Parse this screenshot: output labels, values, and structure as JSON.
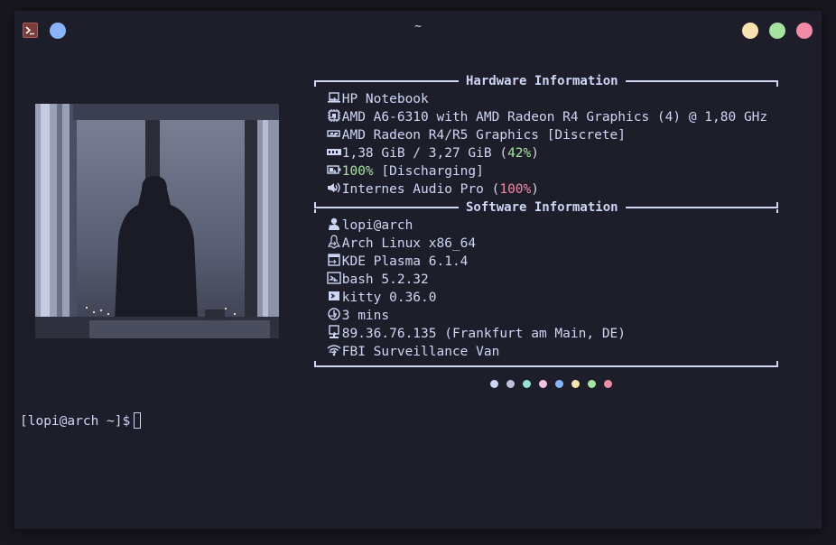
{
  "window": {
    "title": "~",
    "traffic_colors": [
      "#f9e2af",
      "#a6e3a1",
      "#f38ba8"
    ],
    "accent_dot_color": "#89b4fa"
  },
  "hardware": {
    "title": "Hardware Information",
    "rows": [
      {
        "icon": "laptop-icon",
        "text": "HP Notebook"
      },
      {
        "icon": "cpu-icon",
        "text": "AMD A6-6310 with AMD Radeon R4 Graphics (4) @ 1,80 GHz"
      },
      {
        "icon": "gpu-icon",
        "text": "AMD Radeon R4/R5 Graphics [Discrete]"
      },
      {
        "icon": "memory-icon",
        "prefix": "1,38 GiB / 3,27 GiB (",
        "value": "42%",
        "suffix": ")"
      },
      {
        "icon": "battery-icon",
        "value": "100%",
        "suffix": " [Discharging]"
      },
      {
        "icon": "speaker-icon",
        "prefix": "Internes Audio Pro (",
        "value": "100%",
        "suffix": ")"
      }
    ]
  },
  "software": {
    "title": "Software Information",
    "rows": [
      {
        "icon": "user-icon",
        "text": "lopi@arch"
      },
      {
        "icon": "linux-icon",
        "text": "Arch Linux x86_64"
      },
      {
        "icon": "window-icon",
        "text": "KDE Plasma 6.1.4"
      },
      {
        "icon": "terminal-icon",
        "text": "bash 5.2.32"
      },
      {
        "icon": "kitty-icon",
        "text": "kitty 0.36.0"
      },
      {
        "icon": "clock-icon",
        "text": "3 mins"
      },
      {
        "icon": "network-icon",
        "text": "89.36.76.135 (Frankfurt am Main, DE)"
      },
      {
        "icon": "wifi-icon",
        "text": "FBI Surveillance Van"
      }
    ]
  },
  "arrow": "→",
  "palette_colors": [
    "#cdd6f4",
    "#bac2de",
    "#94e2d5",
    "#f5c2e7",
    "#89b4fa",
    "#f9e2af",
    "#a6e3a1",
    "#f38ba8"
  ],
  "prompt": {
    "text": "[lopi@arch ~]$"
  }
}
